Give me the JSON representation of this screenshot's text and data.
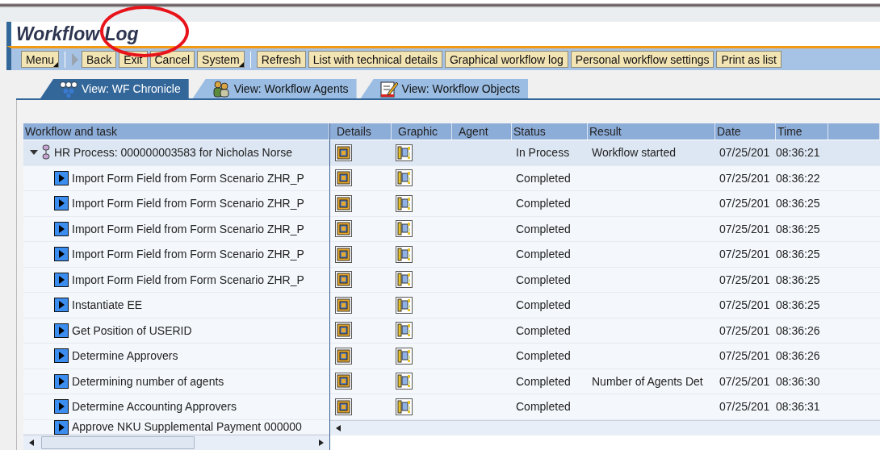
{
  "window": {
    "title": "Workflow Log"
  },
  "toolbar": [
    {
      "kind": "button",
      "label": "Menu",
      "dropdown": true
    },
    {
      "kind": "separator"
    },
    {
      "kind": "arrow"
    },
    {
      "kind": "button",
      "label": "Back",
      "dropdown": false
    },
    {
      "kind": "button",
      "label": "Exit",
      "dropdown": false
    },
    {
      "kind": "button",
      "label": "Cancel",
      "dropdown": false
    },
    {
      "kind": "button",
      "label": "System",
      "dropdown": true
    },
    {
      "kind": "separator"
    },
    {
      "kind": "button",
      "label": "Refresh",
      "dropdown": false
    },
    {
      "kind": "button",
      "label": "List with technical details",
      "dropdown": false
    },
    {
      "kind": "button",
      "label": "Graphical workflow log",
      "dropdown": false
    },
    {
      "kind": "button",
      "label": "Personal workflow settings",
      "dropdown": false
    },
    {
      "kind": "button",
      "label": "Print as list",
      "dropdown": false
    }
  ],
  "annotations": [
    {
      "kind": "ellipse"
    }
  ],
  "tabs": [
    {
      "label": "View: WF Chronicle",
      "selected": true
    },
    {
      "label": "View: Workflow Agents",
      "selected": false
    },
    {
      "label": "View: Workflow Objects",
      "selected": false
    }
  ],
  "table": {
    "columns": [
      "Workflow and task",
      "Details",
      "Graphic",
      "Agent",
      "Status",
      "Result",
      "Date",
      "Time"
    ],
    "tree": {
      "label": "HR Process: 000000003583 for Nicholas Norse",
      "expanded": true,
      "status": "In Process",
      "result": "Workflow started",
      "date": "07/25/201",
      "time": "08:36:21",
      "children": [
        {
          "label": "Import Form Field from Form Scenario ZHR_P",
          "status": "Completed",
          "date": "07/25/201",
          "time": "08:36:22"
        },
        {
          "label": "Import Form Field from Form Scenario ZHR_P",
          "status": "Completed",
          "date": "07/25/201",
          "time": "08:36:25"
        },
        {
          "label": "Import Form Field from Form Scenario ZHR_P",
          "status": "Completed",
          "date": "07/25/201",
          "time": "08:36:25"
        },
        {
          "label": "Import Form Field from Form Scenario ZHR_P",
          "status": "Completed",
          "date": "07/25/201",
          "time": "08:36:25"
        },
        {
          "label": "Import Form Field from Form Scenario ZHR_P",
          "status": "Completed",
          "date": "07/25/201",
          "time": "08:36:25"
        },
        {
          "label": "Instantiate EE",
          "status": "Completed",
          "date": "07/25/201",
          "time": "08:36:25"
        },
        {
          "label": "Get Position of USERID",
          "status": "Completed",
          "date": "07/25/201",
          "time": "08:36:26"
        },
        {
          "label": "Determine Approvers",
          "status": "Completed",
          "date": "07/25/201",
          "time": "08:36:26"
        },
        {
          "label": "Determining number of agents",
          "status": "Completed",
          "result": "Number of Agents Det",
          "date": "07/25/201",
          "time": "08:36:30"
        },
        {
          "label": "Determine Accounting Approvers",
          "status": "Completed",
          "date": "07/25/201",
          "time": "08:36:31"
        },
        {
          "label": "Approve NKU Supplemental Payment 000000"
        }
      ]
    }
  }
}
